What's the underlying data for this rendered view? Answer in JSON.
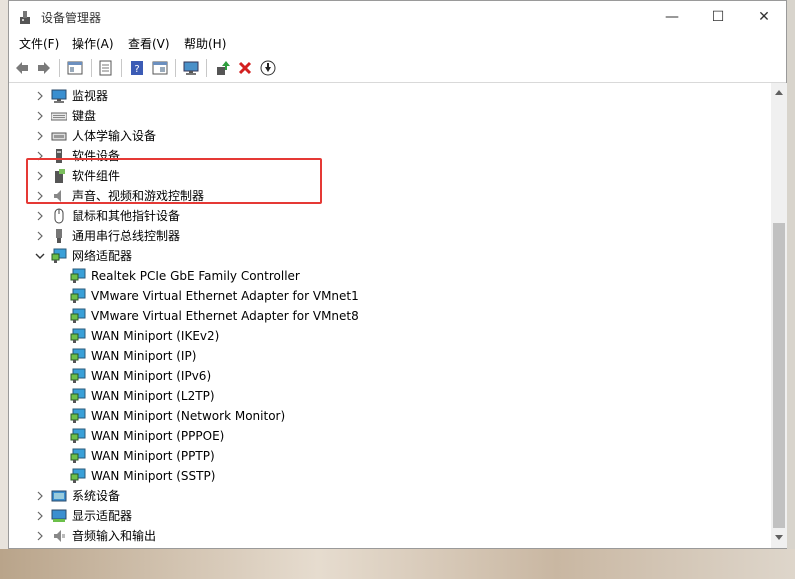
{
  "window": {
    "title": "设备管理器",
    "minimize": "—",
    "maximize": "☐",
    "close": "✕"
  },
  "menus": [
    "文件(F)",
    "操作(A)",
    "查看(V)",
    "帮助(H)"
  ],
  "toolbar": [
    "back-icon",
    "forward-icon",
    "properties-view-icon",
    "properties-icon",
    "help-icon",
    "console-icon",
    "monitor-icon",
    "update-driver-icon",
    "uninstall-icon",
    "download-icon"
  ],
  "tree": [
    {
      "label": "监视器",
      "icon": "monitor-icon",
      "expanded": false
    },
    {
      "label": "键盘",
      "icon": "keyboard-icon",
      "expanded": false
    },
    {
      "label": "人体学输入设备",
      "icon": "hid-icon",
      "expanded": false
    },
    {
      "label": "软件设备",
      "icon": "software-device-icon",
      "expanded": false
    },
    {
      "label": "软件组件",
      "icon": "software-component-icon",
      "expanded": false
    },
    {
      "label": "声音、视频和游戏控制器",
      "icon": "speaker-icon",
      "expanded": false
    },
    {
      "label": "鼠标和其他指针设备",
      "icon": "mouse-icon",
      "expanded": false
    },
    {
      "label": "通用串行总线控制器",
      "icon": "usb-icon",
      "expanded": false
    },
    {
      "label": "网络适配器",
      "icon": "network-adapter-icon",
      "expanded": true,
      "children": [
        "Realtek PCIe GbE Family Controller",
        "VMware Virtual Ethernet Adapter for VMnet1",
        "VMware Virtual Ethernet Adapter for VMnet8",
        "WAN Miniport (IKEv2)",
        "WAN Miniport (IP)",
        "WAN Miniport (IPv6)",
        "WAN Miniport (L2TP)",
        "WAN Miniport (Network Monitor)",
        "WAN Miniport (PPPOE)",
        "WAN Miniport (PPTP)",
        "WAN Miniport (SSTP)"
      ]
    },
    {
      "label": "系统设备",
      "icon": "system-device-icon",
      "expanded": false
    },
    {
      "label": "显示适配器",
      "icon": "display-adapter-icon",
      "expanded": false
    },
    {
      "label": "音频输入和输出",
      "icon": "audio-io-icon",
      "expanded": false
    }
  ],
  "colors": {
    "highlight": "#e53935",
    "scroll_thumb": "#c1c1c1"
  }
}
